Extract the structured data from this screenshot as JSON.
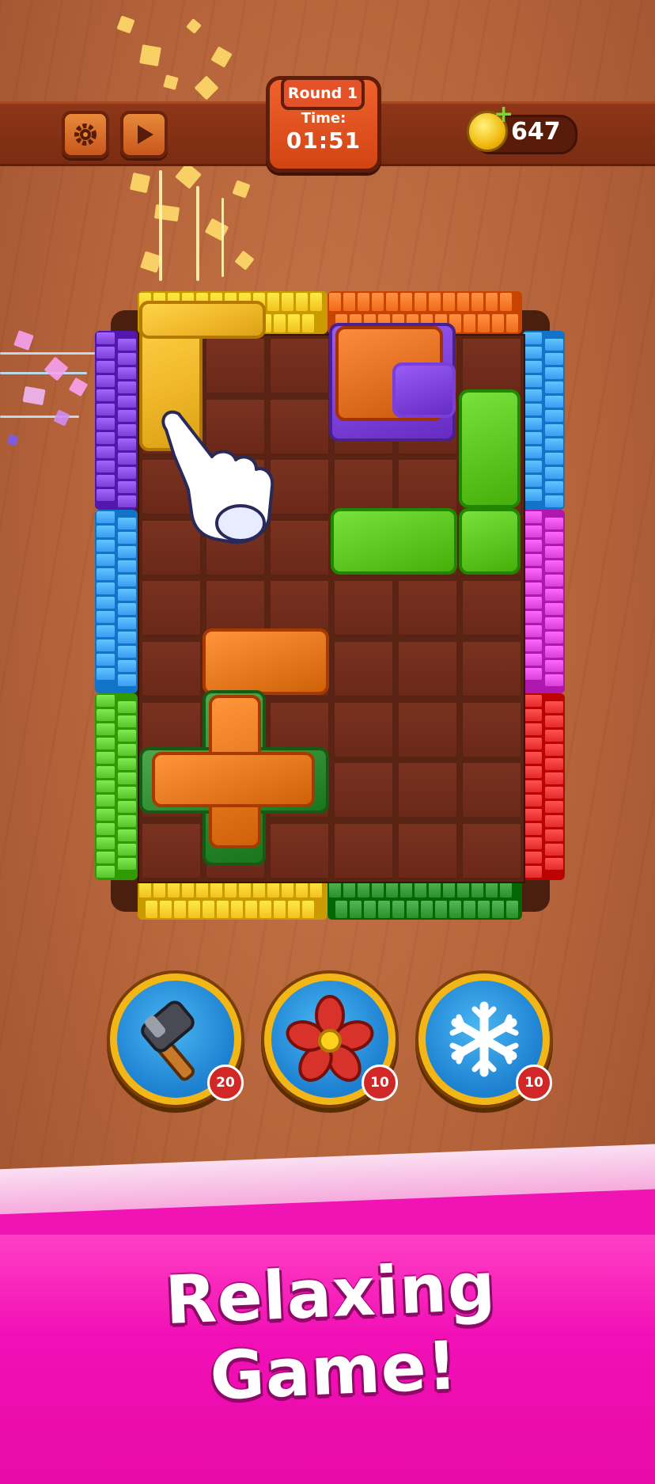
{
  "hud": {
    "round_label": "Round 1",
    "time_label": "Time:",
    "time_value": "01:51",
    "coins": "647",
    "settings_icon": "gear-icon",
    "play_icon": "play-icon",
    "coin_icon": "coin-plus-icon"
  },
  "board": {
    "columns": 6,
    "rows": 9,
    "walls": {
      "top": [
        "#f2c21e",
        "#f06a1a"
      ],
      "left": [
        "#7b3fd6",
        "#3a9cf0",
        "#58c22a"
      ],
      "right": [
        "#3a9cf0",
        "#d73fd6",
        "#e42a2a"
      ],
      "bottom": [
        "#f2c21e",
        "#2b8f2b"
      ]
    },
    "pieces": [
      {
        "color": "#f0b62a",
        "shape": "L-yellow"
      },
      {
        "color": "#e06d1e",
        "shape": "L-orange-on-purple"
      },
      {
        "color": "#5bc31e",
        "shape": "J-green"
      },
      {
        "color": "#e3761c",
        "shape": "bar-orange"
      },
      {
        "color": "#e3761c",
        "shape": "plus-orange-on-green"
      }
    ]
  },
  "tutorial": {
    "hand_icon": "pointing-hand-icon"
  },
  "boosters": [
    {
      "name": "hammer",
      "icon": "hammer-icon",
      "count": "20"
    },
    {
      "name": "fan",
      "icon": "fan-icon",
      "count": "10"
    },
    {
      "name": "freeze",
      "icon": "snowflake-icon",
      "count": "10"
    }
  ],
  "banner": {
    "tagline": "Relaxing Game!"
  }
}
